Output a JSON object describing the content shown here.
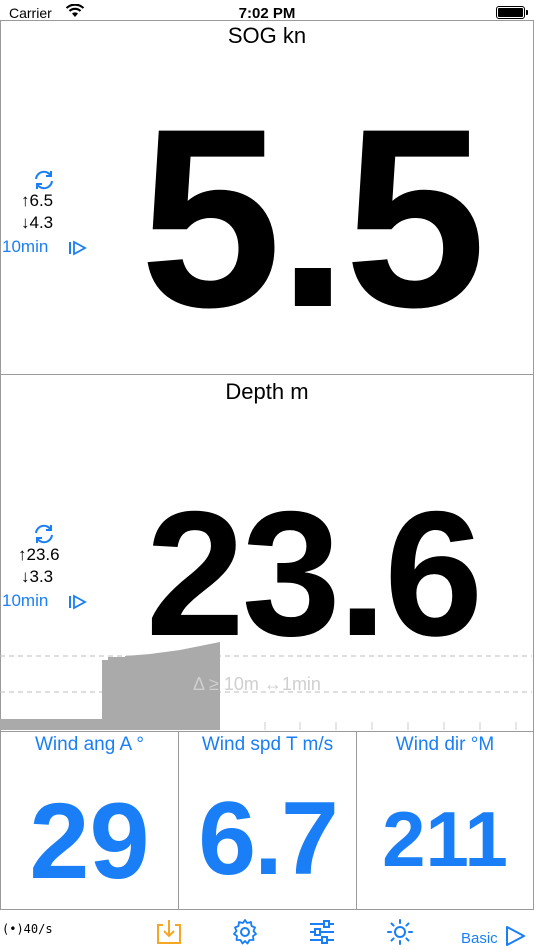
{
  "status": {
    "carrier": "Carrier",
    "time": "7:02 PM"
  },
  "sog": {
    "title": "SOG kn",
    "value": "5.5",
    "max": "↑6.5",
    "min": "↓4.3",
    "interval": "10min"
  },
  "depth": {
    "title": "Depth m",
    "value": "23.6",
    "max": "↑23.6",
    "min": "↓3.3",
    "interval": "10min",
    "chart_label": "Δ ≥ 10m ↔1min"
  },
  "wind_angle": {
    "title": "Wind ang A °",
    "value": "29"
  },
  "wind_speed": {
    "title": "Wind spd T m/s",
    "value": "6.7"
  },
  "wind_dir": {
    "title": "Wind dir °M",
    "value": "211"
  },
  "toolbar": {
    "rate": "(•)40/s",
    "mode": "Basic"
  },
  "colors": {
    "accent": "#1a7ff6",
    "import_icon": "#f5a623",
    "chart_fill": "#aaaaaa"
  },
  "icons": [
    "wifi-icon",
    "battery-icon",
    "refresh-icon",
    "play-icon",
    "import-icon",
    "gear-icon",
    "sliders-icon",
    "brightness-icon"
  ]
}
